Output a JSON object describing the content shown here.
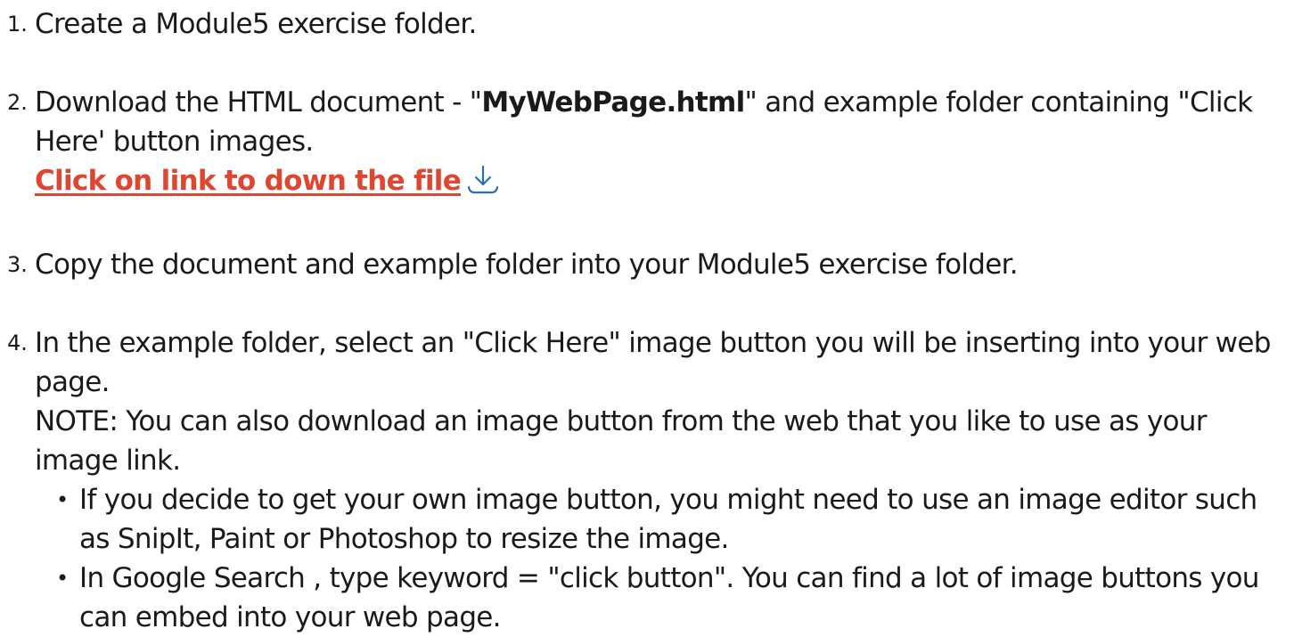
{
  "steps": [
    {
      "number": "1.",
      "text": "Create a Module5 exercise folder."
    },
    {
      "number": "2.",
      "text_before": "Download the HTML document - \"",
      "text_bold": "MyWebPage.html",
      "text_after": "\" and example folder containing \"Click Here' button images.",
      "link_label": "Click on link to down the file",
      "link_icon": "download-arrow-icon",
      "link_color": "#e0452f",
      "icon_color": "#2a6ebb"
    },
    {
      "number": "3.",
      "text": "Copy the document and example folder into your Module5 exercise folder."
    },
    {
      "number": "4.",
      "text": "In the example folder, select an \"Click Here\" image button you will be inserting into your web page.",
      "note": "NOTE:  You can also download an image button from the web that you like to use as your image link.",
      "bullets": [
        "If you decide to get your own image button, you might need to use an image editor such as SnipIt, Paint or Photoshop to resize the image.",
        "In Google Search , type keyword = \"click button\".  You can find a lot of image buttons you can embed into your web page."
      ]
    }
  ]
}
